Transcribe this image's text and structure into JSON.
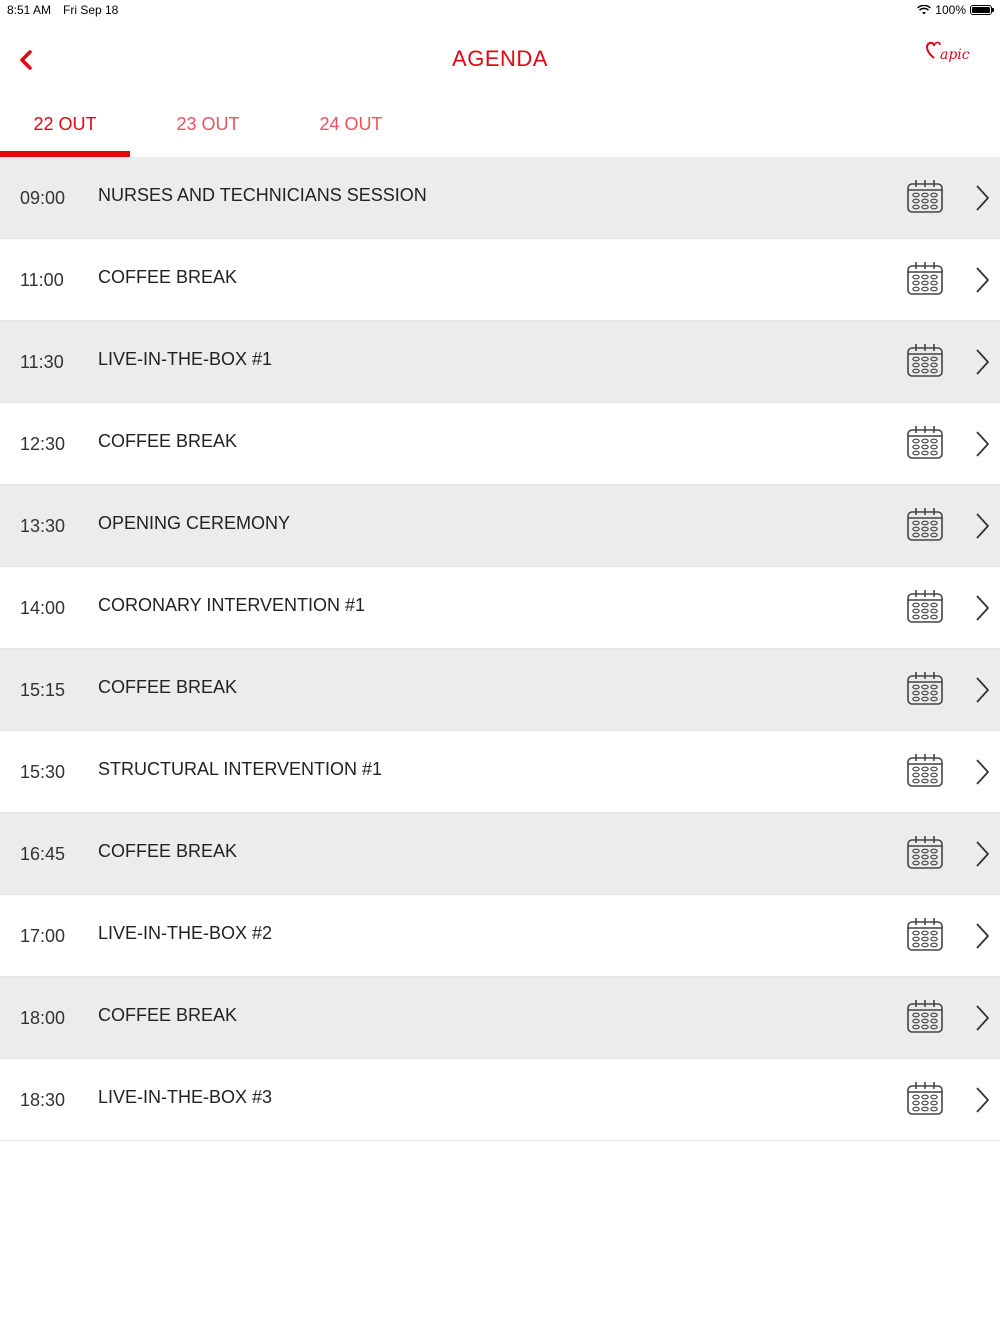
{
  "status_bar": {
    "time": "8:51 AM",
    "date": "Fri Sep 18",
    "battery": "100%"
  },
  "nav": {
    "title": "AGENDA",
    "logo_text": "apic",
    "back_icon": "chevron-left-icon"
  },
  "colors": {
    "accent": "#e30613",
    "row_shade": "#ececec"
  },
  "tabs": [
    {
      "label": "22 OUT",
      "active": true
    },
    {
      "label": "23 OUT",
      "active": false
    },
    {
      "label": "24 OUT",
      "active": false
    }
  ],
  "agenda": [
    {
      "time": "09:00",
      "title": "NURSES AND TECHNICIANS SESSION"
    },
    {
      "time": "11:00",
      "title": "COFFEE BREAK"
    },
    {
      "time": "11:30",
      "title": "LIVE-IN-THE-BOX #1"
    },
    {
      "time": "12:30",
      "title": "COFFEE BREAK"
    },
    {
      "time": "13:30",
      "title": "OPENING CEREMONY"
    },
    {
      "time": "14:00",
      "title": "CORONARY INTERVENTION #1"
    },
    {
      "time": "15:15",
      "title": "COFFEE BREAK"
    },
    {
      "time": "15:30",
      "title": "STRUCTURAL INTERVENTION #1"
    },
    {
      "time": "16:45",
      "title": "COFFEE BREAK"
    },
    {
      "time": "17:00",
      "title": "LIVE-IN-THE-BOX #2"
    },
    {
      "time": "18:00",
      "title": "COFFEE BREAK"
    },
    {
      "time": "18:30",
      "title": "LIVE-IN-THE-BOX #3"
    }
  ]
}
